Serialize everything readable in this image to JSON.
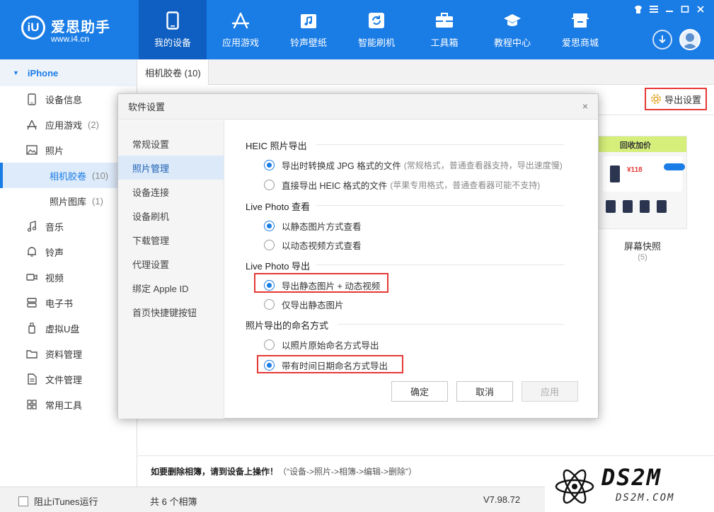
{
  "app": {
    "logo_mark": "iU",
    "name": "爱思助手",
    "url": "www.i4.cn"
  },
  "nav": [
    {
      "label": "我的设备",
      "icon": "phone-icon"
    },
    {
      "label": "应用游戏",
      "icon": "app-store-icon"
    },
    {
      "label": "铃声壁纸",
      "icon": "music-note-icon"
    },
    {
      "label": "智能刷机",
      "icon": "refresh-icon"
    },
    {
      "label": "工具箱",
      "icon": "toolbox-icon"
    },
    {
      "label": "教程中心",
      "icon": "graduation-cap-icon"
    },
    {
      "label": "爱思商城",
      "icon": "shop-icon"
    }
  ],
  "sidebar": {
    "device": "iPhone",
    "items": [
      {
        "label": "设备信息",
        "icon": "phone-info-icon",
        "count": ""
      },
      {
        "label": "应用游戏",
        "icon": "app-icon",
        "count": "(2)"
      },
      {
        "label": "照片",
        "icon": "photo-icon",
        "count": ""
      },
      {
        "label": "相机胶卷",
        "icon": "",
        "count": "(10)"
      },
      {
        "label": "照片图库",
        "icon": "",
        "count": "(1)"
      },
      {
        "label": "音乐",
        "icon": "music-icon",
        "count": ""
      },
      {
        "label": "铃声",
        "icon": "bell-icon",
        "count": ""
      },
      {
        "label": "视频",
        "icon": "video-icon",
        "count": ""
      },
      {
        "label": "电子书",
        "icon": "book-icon",
        "count": ""
      },
      {
        "label": "虚拟U盘",
        "icon": "usb-icon",
        "count": ""
      },
      {
        "label": "资料管理",
        "icon": "folder-icon",
        "count": ""
      },
      {
        "label": "文件管理",
        "icon": "file-icon",
        "count": ""
      },
      {
        "label": "常用工具",
        "icon": "grid-icon",
        "count": ""
      }
    ]
  },
  "main": {
    "tab": "相机胶卷 (10)",
    "export_settings": "导出设置",
    "album": {
      "name": "屏幕快照",
      "count": "(5)",
      "thumb_banner": "回收加价",
      "thumb_price": "¥118"
    },
    "hint": {
      "text": "如要删除相簿，请到设备上操作！",
      "path": "（“设备->照片->相簿->编辑->删除”）"
    }
  },
  "statusbar": {
    "itunes": "阻止iTunes运行",
    "albums": "共 6 个相簿",
    "version": "V7.98.72"
  },
  "watermark": {
    "big": "DS2M",
    "small": "DS2M.COM"
  },
  "dialog": {
    "title": "软件设置",
    "close": "×",
    "nav": [
      "常规设置",
      "照片管理",
      "设备连接",
      "设备刷机",
      "下载管理",
      "代理设置",
      "绑定 Apple ID",
      "首页快捷键按钮"
    ],
    "sections": {
      "heic": {
        "title": "HEIC 照片导出",
        "opt1": "导出时转换成 JPG 格式的文件",
        "opt1_note": "(常规格式，普通查看器支持，导出速度慢)",
        "opt2": "直接导出 HEIC 格式的文件",
        "opt2_note": "(苹果专用格式，普通查看器可能不支持)"
      },
      "live_view": {
        "title": "Live Photo 查看",
        "opt1": "以静态图片方式查看",
        "opt2": "以动态视频方式查看"
      },
      "live_export": {
        "title": "Live Photo 导出",
        "opt1": "导出静态图片 + 动态视频",
        "opt2": "仅导出静态图片"
      },
      "naming": {
        "title": "照片导出的命名方式",
        "opt1": "以照片原始命名方式导出",
        "opt2": "带有时间日期命名方式导出"
      }
    },
    "buttons": {
      "ok": "确定",
      "cancel": "取消",
      "apply": "应用"
    }
  },
  "colors": {
    "accent": "#1a7ce5",
    "highlight": "#e53935"
  }
}
